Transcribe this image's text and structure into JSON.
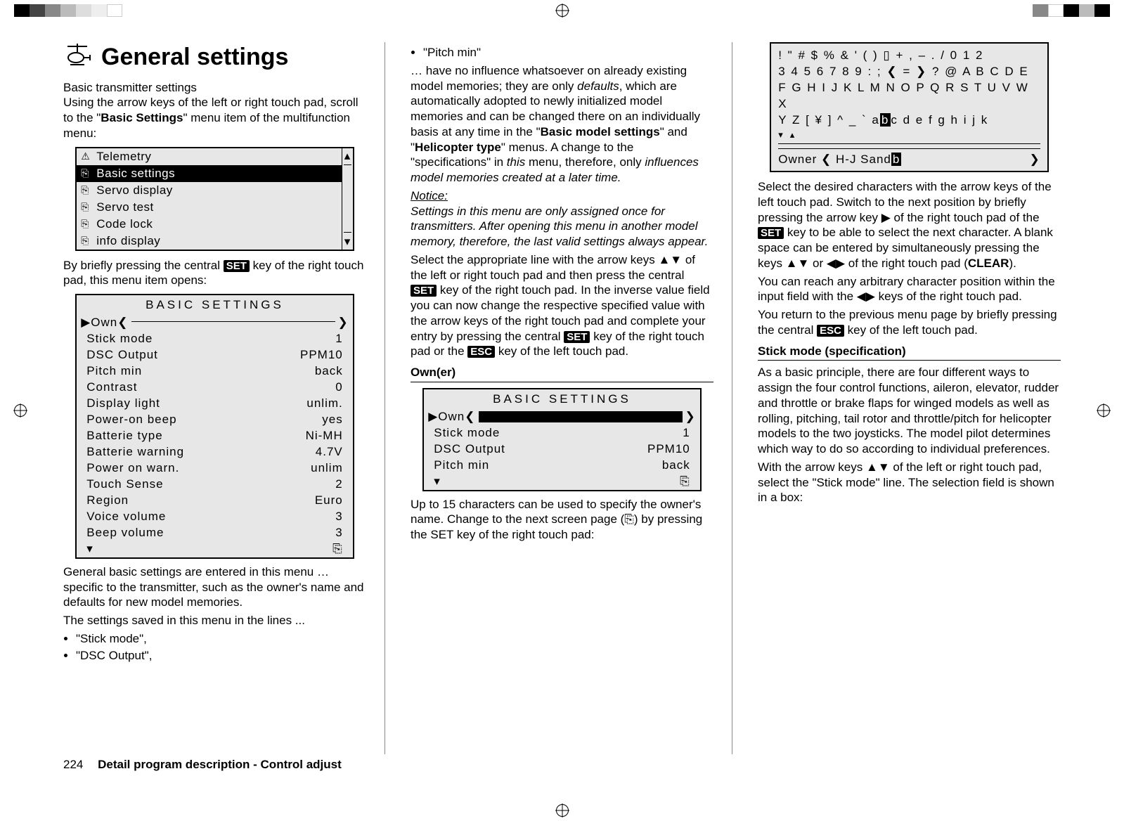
{
  "page_number": "224",
  "footer_text": "Detail program description - Control adjust",
  "title": "General settings",
  "subtitle": "Basic transmitter settings",
  "col1": {
    "intro1": "Using the arrow keys of the left or right touch pad, scroll to the \"",
    "intro1_bold": "Basic Settings",
    "intro1_end": "\" menu item of the multifunction menu:",
    "menu_items": [
      "Telemetry",
      "Basic settings",
      "Servo display",
      "Servo test",
      "Code lock",
      "info display"
    ],
    "menu_selected_index": 1,
    "after_menu_a": "By briefly pressing the central ",
    "key_set": "SET",
    "after_menu_b": " key of the right touch pad, this menu item opens:",
    "settings_title": "BASIC  SETTINGS",
    "own_label": "▶Own",
    "rows": [
      {
        "lab": "Stick mode",
        "val": "1"
      },
      {
        "lab": "DSC Output",
        "val": "PPM10"
      },
      {
        "lab": "Pitch min",
        "val": "back"
      },
      {
        "lab": "Contrast",
        "val": "0"
      },
      {
        "lab": "Display light",
        "val": "unlim."
      },
      {
        "lab": "Power-on beep",
        "val": "yes"
      },
      {
        "lab": "Batterie type",
        "val": "Ni-MH"
      },
      {
        "lab": "Batterie warning",
        "val": "4.7V"
      },
      {
        "lab": "Power on warn.",
        "val": "unlim"
      },
      {
        "lab": "Touch Sense",
        "val": "2"
      },
      {
        "lab": "Region",
        "val": "Euro"
      },
      {
        "lab": "Voice volume",
        "val": "3"
      },
      {
        "lab": "Beep volume",
        "val": "3"
      }
    ],
    "para2a": "General basic settings are entered in this menu … specific to the transmitter, such as  the owner's name and defaults for new model memories.",
    "para2b": "The settings saved in this menu in the lines ...",
    "bullets": [
      "\"Stick mode\",",
      "\"DSC Output\","
    ]
  },
  "col2": {
    "bullet1": "\"Pitch min\"",
    "p1a": "… have no influence whatsoever on already existing model memories; they are only ",
    "p1a_it": "defaults",
    "p1b": ", which are automatically adopted to newly initialized model memories and can be changed there on an individually basis at any time in the \"",
    "p1b_bold1": "Basic model settings",
    "p1c": "\" and \"",
    "p1b_bold2": "Helicopter type",
    "p1d": "\" menus. A change to the \"specifications\" in ",
    "p1d_it": "this",
    "p1e": " menu, therefore, only ",
    "p1e_it": "influences model memories created at a later time.",
    "notice_head": "Notice:",
    "notice_body": "Settings in this menu are only assigned once for transmitters. After opening this menu in another model memory, therefore, the last valid settings always appear.",
    "p2a": "Select the appropriate line with the arrow keys ▲▼ of the left or right touch pad and then press the central ",
    "p2b": " key of the right touch pad. In the inverse value field you can now change the respective specified value with the arrow keys of the right touch pad and complete your entry by pressing the central ",
    "p2c": " key of the right touch pad or the ",
    "key_esc": "ESC",
    "p2d": " key of the left touch pad.",
    "section_own": "Own(er)",
    "settings2_title": "BASIC  SETTINGS",
    "own2_label": "▶Own",
    "rows2": [
      {
        "lab": "Stick mode",
        "val": "1"
      },
      {
        "lab": "DSC Output",
        "val": "PPM10"
      },
      {
        "lab": "Pitch min",
        "val": "back"
      }
    ],
    "p3": "Up to 15 characters can be used to specify the owner's name. Change to the next screen page (⎘) by pressing the SET key of the right touch pad:"
  },
  "col3": {
    "charmap_lines": [
      " ! \" # $ % & ' ( ) ▯ + , – . / 0 1 2",
      "3 4 5 6 7 8 9 : ; ❮ = ❯ ? @ A B C D E",
      "F G H I J K L M N O P Q R S T U V W X",
      "Y Z [ ¥ ] ^ _ ` a"
    ],
    "charmap_hl": "b",
    "charmap_tail": "c d e f g h i j k",
    "owner_label": "Owner",
    "owner_value": "H-J Sand",
    "owner_cursor": "b",
    "p1a": "Select the desired characters with the arrow keys of the left touch pad. Switch to the next position by briefly pressing the arrow key ▶ of the right touch pad of the ",
    "p1b": " key to be able to select the next character. A blank space can be entered by simultaneously pressing the keys ▲▼ or ◀▶ of the right touch pad (",
    "p1b_bold": "CLEAR",
    "p1c": ").",
    "p2": "You can reach any arbitrary character position within the input field with the ◀▶ keys of the right touch pad.",
    "p3a": "You return to the previous menu page by briefly pressing the central ",
    "p3b": " key of the left touch pad.",
    "section_stick": "Stick mode (specification)",
    "p4": "As a basic principle, there are four different ways to assign the four control functions, aileron, elevator, rudder and throttle or brake flaps for winged models as well as rolling, pitching, tail rotor and throttle/pitch for helicopter models to the two joysticks. The model pilot determines which way to do so according to individual preferences.",
    "p5": "With the arrow keys ▲▼ of the left or right touch pad, select the \"Stick mode\" line. The selection field is shown in a box:"
  }
}
